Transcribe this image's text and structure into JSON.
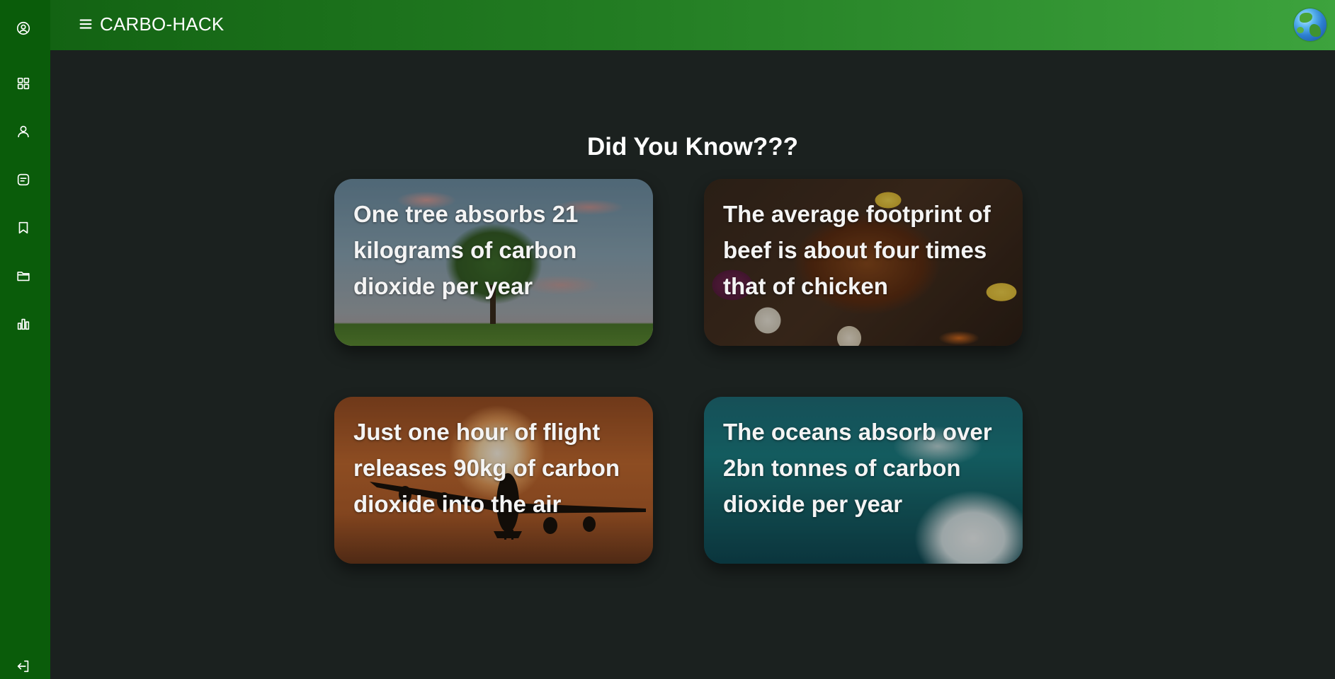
{
  "app": {
    "brand": "CARBO-HACK"
  },
  "sidebar": {
    "items": [
      {
        "icon": "user-circle-icon"
      },
      {
        "icon": "grid-icon"
      },
      {
        "icon": "user-icon"
      },
      {
        "icon": "message-icon"
      },
      {
        "icon": "bookmark-icon"
      },
      {
        "icon": "folder-icon"
      },
      {
        "icon": "bar-chart-icon"
      },
      {
        "icon": "logout-icon"
      }
    ]
  },
  "main": {
    "section_title": "Did You Know???",
    "facts": [
      {
        "text": "One tree absorbs 21 kilograms of carbon dioxide per year",
        "image": "tree-in-field"
      },
      {
        "text": "The average footprint of beef is about four times that of chicken",
        "image": "roast-chicken-platter"
      },
      {
        "text": "Just one hour of flight releases 90kg of carbon dioxide into the air",
        "image": "airplane-at-sunset"
      },
      {
        "text": "The oceans absorb over 2bn tonnes of carbon dioxide per year",
        "image": "ocean-wave"
      }
    ]
  },
  "colors": {
    "sidebar": "#0a5c0a",
    "topbar_start": "#136313",
    "topbar_end": "#3da33d",
    "background": "#1b211f"
  }
}
